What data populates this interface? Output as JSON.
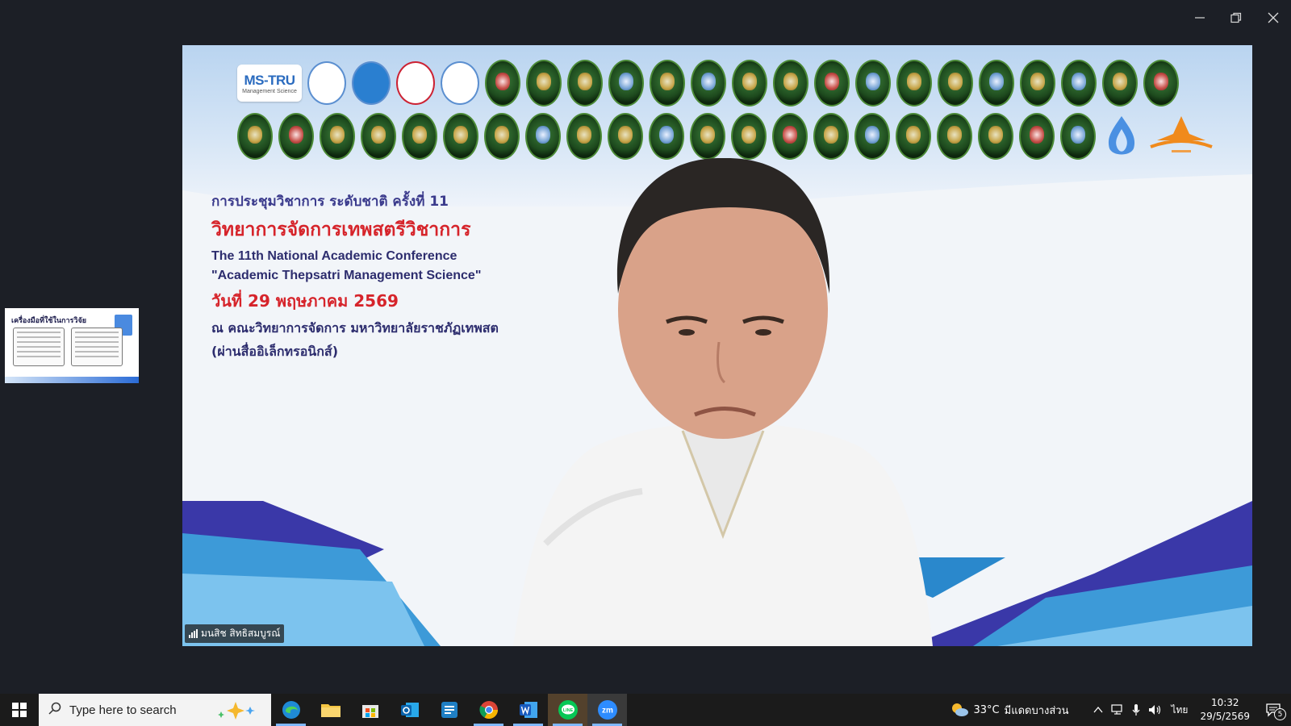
{
  "window": {
    "controls": [
      "minimize",
      "restore",
      "close"
    ]
  },
  "conference": {
    "line1": "การประชุมวิชาการ ระดับชาติ ครั้งที่ 11",
    "line2": "วิทยาการจัดการเทพสตรีวิชาการ",
    "line3": "The 11th National Academic Conference",
    "line4": "\"Academic Thepsatri Management Science\"",
    "line5": "วันที่ 29 พฤษภาคม 2569",
    "line6": "ณ คณะวิทยาการจัดการ มหาวิทยาลัยราชภัฏเทพสต",
    "line7": "(ผ่านสื่ออิเล็กทรอนิกส์)"
  },
  "logos": {
    "mstru": "MS-TRU",
    "mstru_sub": "Management Science"
  },
  "participant": {
    "name": "มนสิช สิทธิสมบูรณ์"
  },
  "thumbnail": {
    "title": "เครื่องมือที่ใช้ในการวิจัย"
  },
  "taskbar": {
    "search_placeholder": "Type here to search",
    "apps": [
      "edge",
      "file-explorer",
      "microsoft-store",
      "outlook",
      "news",
      "chrome",
      "word",
      "line",
      "zoom"
    ],
    "weather_temp": "33°C",
    "weather_text": "มีแดดบางส่วน",
    "language": "ไทย",
    "time": "10:32",
    "date": "29/5/2569",
    "notification_count": "5"
  }
}
